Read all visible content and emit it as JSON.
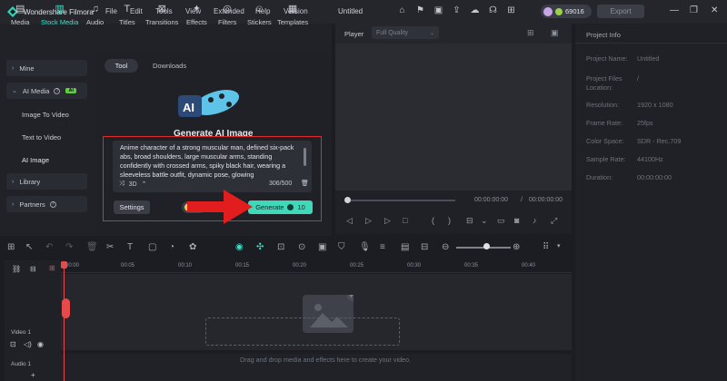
{
  "titlebar": {
    "app_name": "Wondershare Filmora",
    "menu": [
      "File",
      "Edit",
      "Tools",
      "View",
      "Extended",
      "Help",
      "Version"
    ],
    "doc_title": "Untitled",
    "credits": "69016",
    "export": "Export"
  },
  "toolbar": {
    "items": [
      "Media",
      "Stock Media",
      "Audio",
      "Titles",
      "Transitions",
      "Effects",
      "Filters",
      "Stickers",
      "Templates"
    ],
    "active": "Stock Media"
  },
  "sidebar": {
    "mine": "Mine",
    "ai_media": "AI Media",
    "ai_badge": "AI",
    "image_to_video": "Image To Video",
    "text_to_video": "Text to Video",
    "ai_image": "AI Image",
    "library": "Library",
    "partners": "Partners"
  },
  "media": {
    "tab_tool": "Tool",
    "tab_downloads": "Downloads",
    "art_label": "AI",
    "title": "Generate AI Image",
    "prompt": "Anime character of a strong muscular man, defined six-pack abs, broad shoulders, large muscular arms, standing confidently with crossed arms, spiky black hair, wearing a sleeveless battle outfit, dynamic pose, glowing",
    "style": "3D",
    "count": "306/500",
    "settings": "Settings",
    "generate": "Generate",
    "generate_cost": "10"
  },
  "player": {
    "label": "Player",
    "quality": "Full Quality",
    "time_current": "00:00:00:00",
    "time_sep": "/",
    "time_total": "00:00:00:00"
  },
  "project_info": {
    "title": "Project Info",
    "rows": [
      {
        "k": "Project Name:",
        "v": "Untitled"
      },
      {
        "k": "Project Files Location:",
        "v": "/"
      },
      {
        "k": "Resolution:",
        "v": "1920 x 1080"
      },
      {
        "k": "Frame Rate:",
        "v": "25fps"
      },
      {
        "k": "Color Space:",
        "v": "SDR - Rec.709"
      },
      {
        "k": "Sample Rate:",
        "v": "44100Hz"
      },
      {
        "k": "Duration:",
        "v": "00:00:00:00"
      }
    ]
  },
  "timeline": {
    "ticks": [
      "00:00",
      "00:05",
      "00:10",
      "00:15",
      "00:20",
      "00:25",
      "00:30",
      "00:35",
      "00:40"
    ],
    "video_track": "Video 1",
    "audio_track": "Audio 1",
    "drop_hint": "Drag and drop media and effects here to create your video."
  },
  "icons": {
    "brand": "#3fe0c8",
    "generate_bg": "#3fd9b9",
    "highlight_box": "#e02a2a",
    "playhead": "#e64a4a"
  }
}
